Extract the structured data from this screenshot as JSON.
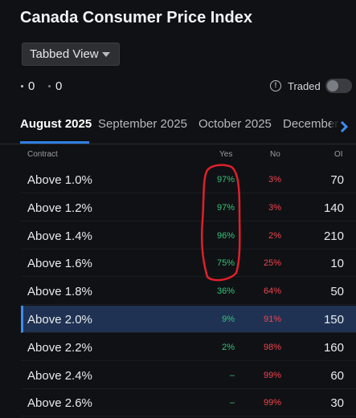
{
  "title": "Canada Consumer Price Index",
  "view_select": {
    "value": "Tabbed View"
  },
  "stats": [
    {
      "value": "0"
    },
    {
      "value": "0"
    }
  ],
  "traded": {
    "label": "Traded",
    "icon": "alert-circle-icon",
    "enabled": false
  },
  "tabs": [
    {
      "label": "August 2025",
      "active": true
    },
    {
      "label": "September 2025",
      "active": false
    },
    {
      "label": "October 2025",
      "active": false
    },
    {
      "label": "December",
      "active": false
    }
  ],
  "table": {
    "headers": {
      "contract": "Contract",
      "yes": "Yes",
      "no": "No",
      "oi": "OI"
    },
    "rows": [
      {
        "contract": "Above 1.0%",
        "yes": "97%",
        "no": "3%",
        "oi": "70"
      },
      {
        "contract": "Above 1.2%",
        "yes": "97%",
        "no": "3%",
        "oi": "140"
      },
      {
        "contract": "Above 1.4%",
        "yes": "96%",
        "no": "2%",
        "oi": "210"
      },
      {
        "contract": "Above 1.6%",
        "yes": "75%",
        "no": "25%",
        "oi": "10"
      },
      {
        "contract": "Above 1.8%",
        "yes": "36%",
        "no": "64%",
        "oi": "50"
      },
      {
        "contract": "Above 2.0%",
        "yes": "9%",
        "no": "91%",
        "oi": "150",
        "selected": true
      },
      {
        "contract": "Above 2.2%",
        "yes": "2%",
        "no": "98%",
        "oi": "160"
      },
      {
        "contract": "Above 2.4%",
        "yes": "–",
        "no": "99%",
        "oi": "60"
      },
      {
        "contract": "Above 2.6%",
        "yes": "–",
        "no": "99%",
        "oi": "30"
      }
    ]
  },
  "colors": {
    "yes": "#37c27a",
    "no": "#ef4452",
    "accent": "#3d8bef",
    "selected_row": "#1f3253",
    "annotation": "#e0202a"
  }
}
